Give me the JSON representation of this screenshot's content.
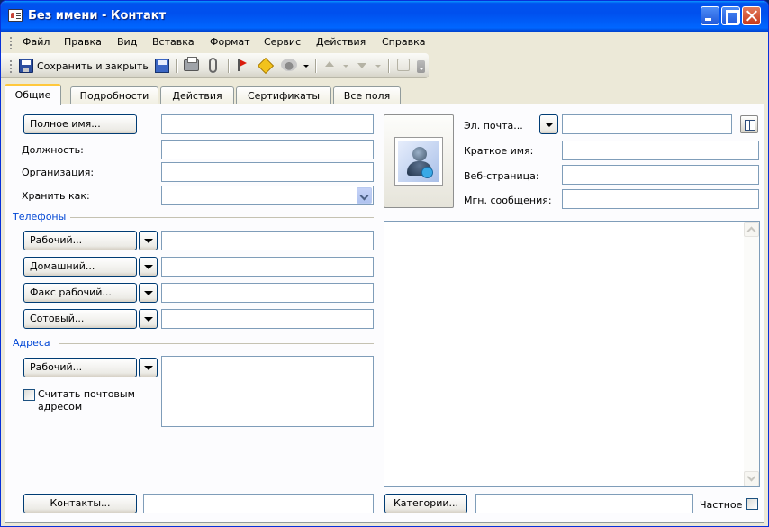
{
  "window": {
    "title": "Без имени - Контакт"
  },
  "menu": {
    "items": [
      "Файл",
      "Правка",
      "Вид",
      "Вставка",
      "Формат",
      "Сервис",
      "Действия",
      "Справка"
    ]
  },
  "toolbar": {
    "save_close_label": "Сохранить и закрыть"
  },
  "tabs": [
    "Общие",
    "Подробности",
    "Действия",
    "Сертификаты",
    "Все поля"
  ],
  "general": {
    "full_name_button": "Полное имя...",
    "full_name_value": "",
    "job_title_label": "Должность:",
    "job_title_value": "",
    "company_label": "Организация:",
    "company_value": "",
    "file_as_label": "Хранить как:",
    "file_as_value": "",
    "phones_section": "Телефоны",
    "phones": [
      {
        "label": "Рабочий...",
        "value": ""
      },
      {
        "label": "Домашний...",
        "value": ""
      },
      {
        "label": "Факс рабочий...",
        "value": ""
      },
      {
        "label": "Сотовый...",
        "value": ""
      }
    ],
    "addresses_section": "Адреса",
    "address_type_button": "Рабочий...",
    "address_value": "",
    "mailing_address_label": "Считать почтовым адресом",
    "email_button": "Эл. почта...",
    "email_value": "",
    "display_as_label": "Краткое имя:",
    "display_as_value": "",
    "web_page_label": "Веб-страница:",
    "web_page_value": "",
    "im_address_label": "Мгн. сообщения:",
    "im_address_value": "",
    "notes_value": "",
    "contacts_button": "Контакты...",
    "contacts_value": "",
    "categories_button": "Категории...",
    "categories_value": "",
    "private_label": "Частное"
  }
}
